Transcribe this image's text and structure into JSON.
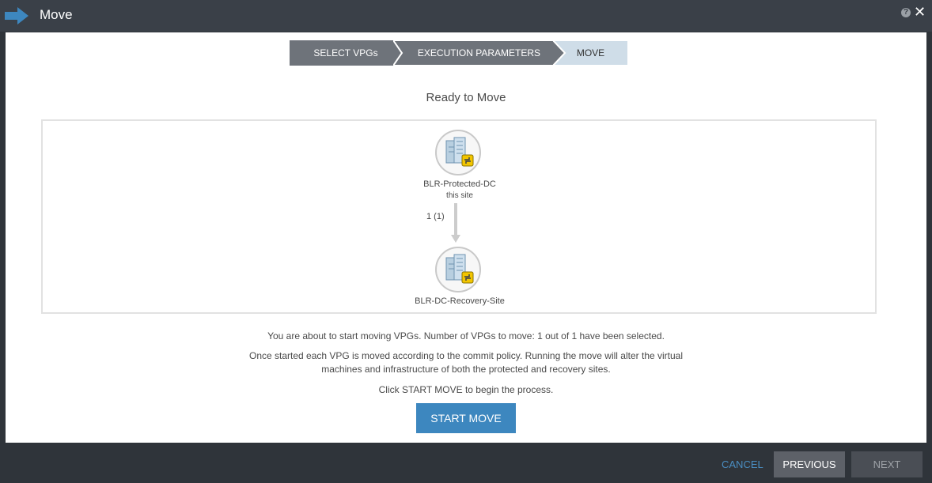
{
  "window": {
    "title": "Move",
    "title_icon": "arrow-right-icon",
    "help_icon": "help-icon",
    "help_glyph": "?",
    "close_icon": "close-icon",
    "close_glyph": "✕"
  },
  "steps": [
    {
      "label": "SELECT VPGs",
      "state": "completed"
    },
    {
      "label": "EXECUTION PARAMETERS",
      "state": "completed"
    },
    {
      "label": "MOVE",
      "state": "active"
    }
  ],
  "main": {
    "heading": "Ready to Move",
    "source_site": {
      "name": "BLR-Protected-DC",
      "sub": "this site",
      "icon": "datacenter-icon"
    },
    "target_site": {
      "name": "BLR-DC-Recovery-Site",
      "icon": "datacenter-icon"
    },
    "vpg_count": "1 (1)",
    "message_1": "You are about to start moving VPGs. Number of VPGs to move: 1 out of 1 have been selected.",
    "message_2_line1": "Once started each VPG is moved according to the commit policy. Running the move will alter the virtual",
    "message_2_line2": "machines and infrastructure of both the protected and recovery sites.",
    "message_3": "Click START MOVE to begin the process.",
    "start_button": "START MOVE"
  },
  "footer": {
    "cancel": "CANCEL",
    "previous": "PREVIOUS",
    "next": "NEXT"
  },
  "colors": {
    "accent_blue": "#3d87bf",
    "step_completed": "#6e737a",
    "step_active": "#cfdde8",
    "titlebar": "#3a4048"
  }
}
